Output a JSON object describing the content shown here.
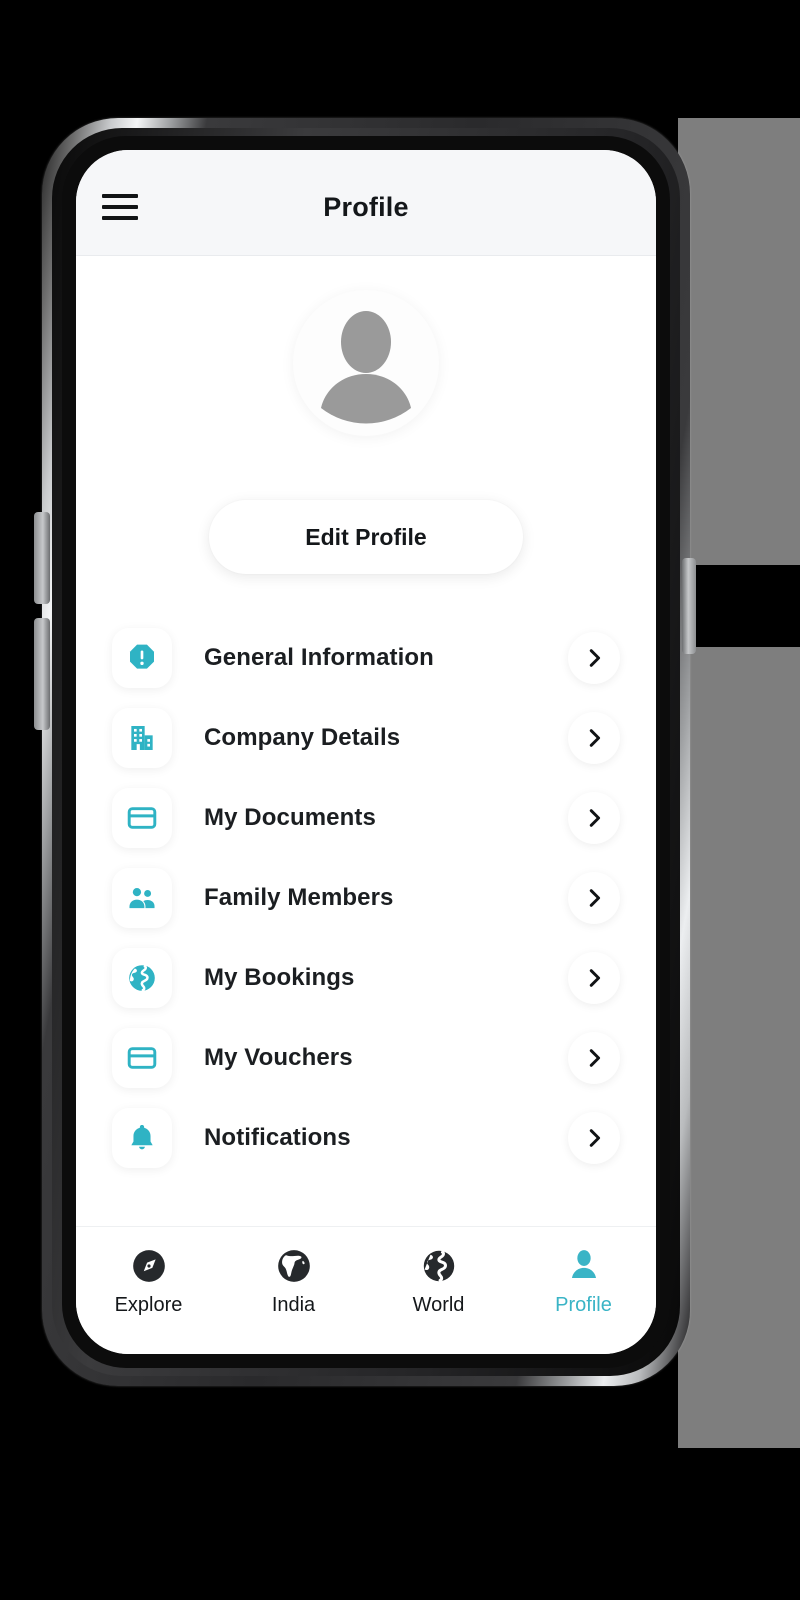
{
  "theme": {
    "accent": "#2fb3c4",
    "accent_light": "#3ab4c6",
    "text_dark": "#14171a",
    "header_bg": "#f6f7f9",
    "screen_bg": "#ffffff",
    "avatar_gray": "#9a9a9a"
  },
  "header": {
    "title": "Profile",
    "menu_icon": "hamburger-icon"
  },
  "profile": {
    "avatar_icon": "user-placeholder-avatar",
    "name": "",
    "edit_button_label": "Edit Profile"
  },
  "menu": {
    "items": [
      {
        "label": "General Information",
        "icon": "alert-octagon-icon",
        "chevron": "chevron-right-icon"
      },
      {
        "label": "Company Details",
        "icon": "building-icon",
        "chevron": "chevron-right-icon"
      },
      {
        "label": "My Documents",
        "icon": "card-icon",
        "chevron": "chevron-right-icon"
      },
      {
        "label": "Family Members",
        "icon": "people-icon",
        "chevron": "chevron-right-icon"
      },
      {
        "label": "My Bookings",
        "icon": "globe-icon",
        "chevron": "chevron-right-icon"
      },
      {
        "label": "My Vouchers",
        "icon": "card-icon",
        "chevron": "chevron-right-icon"
      },
      {
        "label": "Notifications",
        "icon": "bell-icon",
        "chevron": "chevron-right-icon"
      }
    ]
  },
  "bottom_nav": {
    "items": [
      {
        "label": "Explore",
        "icon": "compass-icon",
        "active": false
      },
      {
        "label": "India",
        "icon": "india-map-icon",
        "active": false
      },
      {
        "label": "World",
        "icon": "globe-icon",
        "active": false
      },
      {
        "label": "Profile",
        "icon": "person-icon",
        "active": true
      }
    ]
  },
  "device": {
    "buttons": [
      "volume-up-button",
      "volume-down-button",
      "power-button"
    ]
  }
}
